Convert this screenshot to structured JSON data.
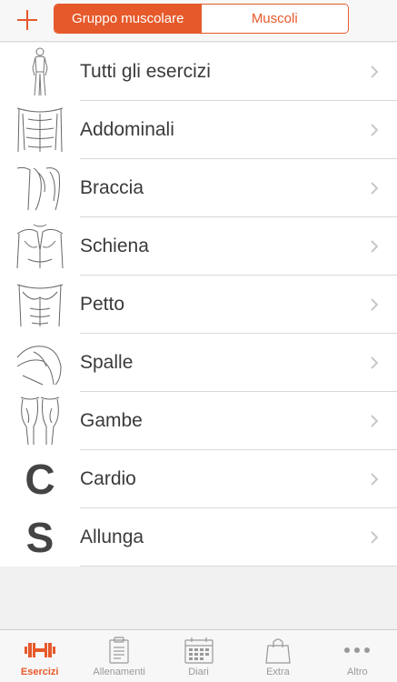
{
  "colors": {
    "accent": "#e6592a",
    "text": "#3a3a3a",
    "inactive": "#999999"
  },
  "header": {
    "add_icon": "plus-icon",
    "segments": [
      {
        "label": "Gruppo muscolare",
        "selected": true
      },
      {
        "label": "Muscoli",
        "selected": false
      }
    ]
  },
  "list": {
    "items": [
      {
        "label": "Tutti gli esercizi",
        "icon": "full-body-icon"
      },
      {
        "label": "Addominali",
        "icon": "abs-icon"
      },
      {
        "label": "Braccia",
        "icon": "arms-icon"
      },
      {
        "label": "Schiena",
        "icon": "back-icon"
      },
      {
        "label": "Petto",
        "icon": "chest-icon"
      },
      {
        "label": "Spalle",
        "icon": "shoulders-icon"
      },
      {
        "label": "Gambe",
        "icon": "legs-icon"
      },
      {
        "label": "Cardio",
        "icon": "letter",
        "letter": "C"
      },
      {
        "label": "Allunga",
        "icon": "letter",
        "letter": "S"
      }
    ]
  },
  "tabbar": {
    "tabs": [
      {
        "label": "Esercizi",
        "icon": "dumbbell-icon",
        "active": true
      },
      {
        "label": "Allenamenti",
        "icon": "clipboard-icon",
        "active": false
      },
      {
        "label": "Diari",
        "icon": "calendar-icon",
        "active": false
      },
      {
        "label": "Extra",
        "icon": "shopping-bag-icon",
        "active": false
      },
      {
        "label": "Altro",
        "icon": "more-dots-icon",
        "active": false
      }
    ]
  }
}
